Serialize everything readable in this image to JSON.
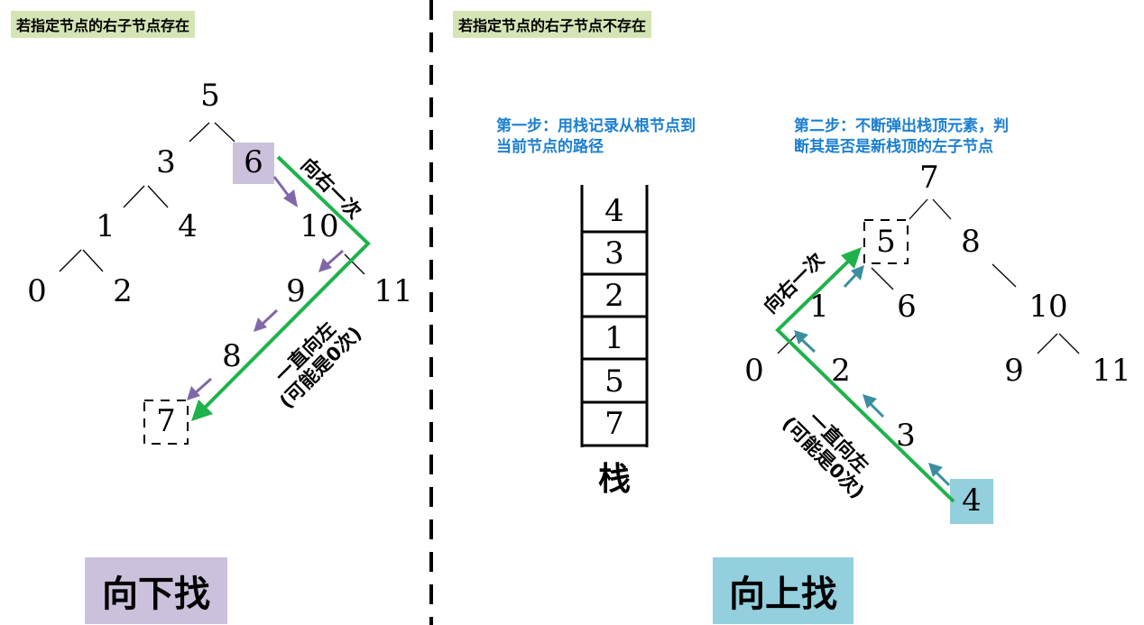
{
  "left_panel": {
    "tag": "若指定节点的右子节点存在",
    "nodes": [
      "5",
      "3",
      "6",
      "1",
      "4",
      "10",
      "0",
      "2",
      "9",
      "11",
      "8",
      "7"
    ],
    "label_right_once": "向右一次",
    "label_always_left_1": "一直向左",
    "label_always_left_2": "(可能是0次)",
    "caption": "向下找"
  },
  "right_panel": {
    "tag": "若指定节点的右子节点不存在",
    "step1_line1": "第一步：用栈记录从根节点到",
    "step1_line2": "当前节点的路径",
    "step2_line1": "第二步：不断弹出栈顶元素，判",
    "step2_line2": "断其是否是新栈顶的左子节点",
    "stack_items": [
      "4",
      "3",
      "2",
      "1",
      "5",
      "7"
    ],
    "stack_label": "栈",
    "nodes": [
      "7",
      "5",
      "8",
      "1",
      "6",
      "10",
      "0",
      "2",
      "9",
      "11",
      "3",
      "4"
    ],
    "label_right_once": "向右一次",
    "label_always_left_1": "一直向左",
    "label_always_left_2": "(可能是0次)",
    "caption": "向上找"
  },
  "colors": {
    "tag_bg": "#d5e4b4",
    "highlight_purple": "#cbc1dc",
    "highlight_teal": "#93cfdc",
    "path_green": "#1fb24b",
    "arrow_purple": "#8068a8",
    "arrow_teal": "#3a8ea0",
    "step_text_blue": "#1c7fd0"
  }
}
